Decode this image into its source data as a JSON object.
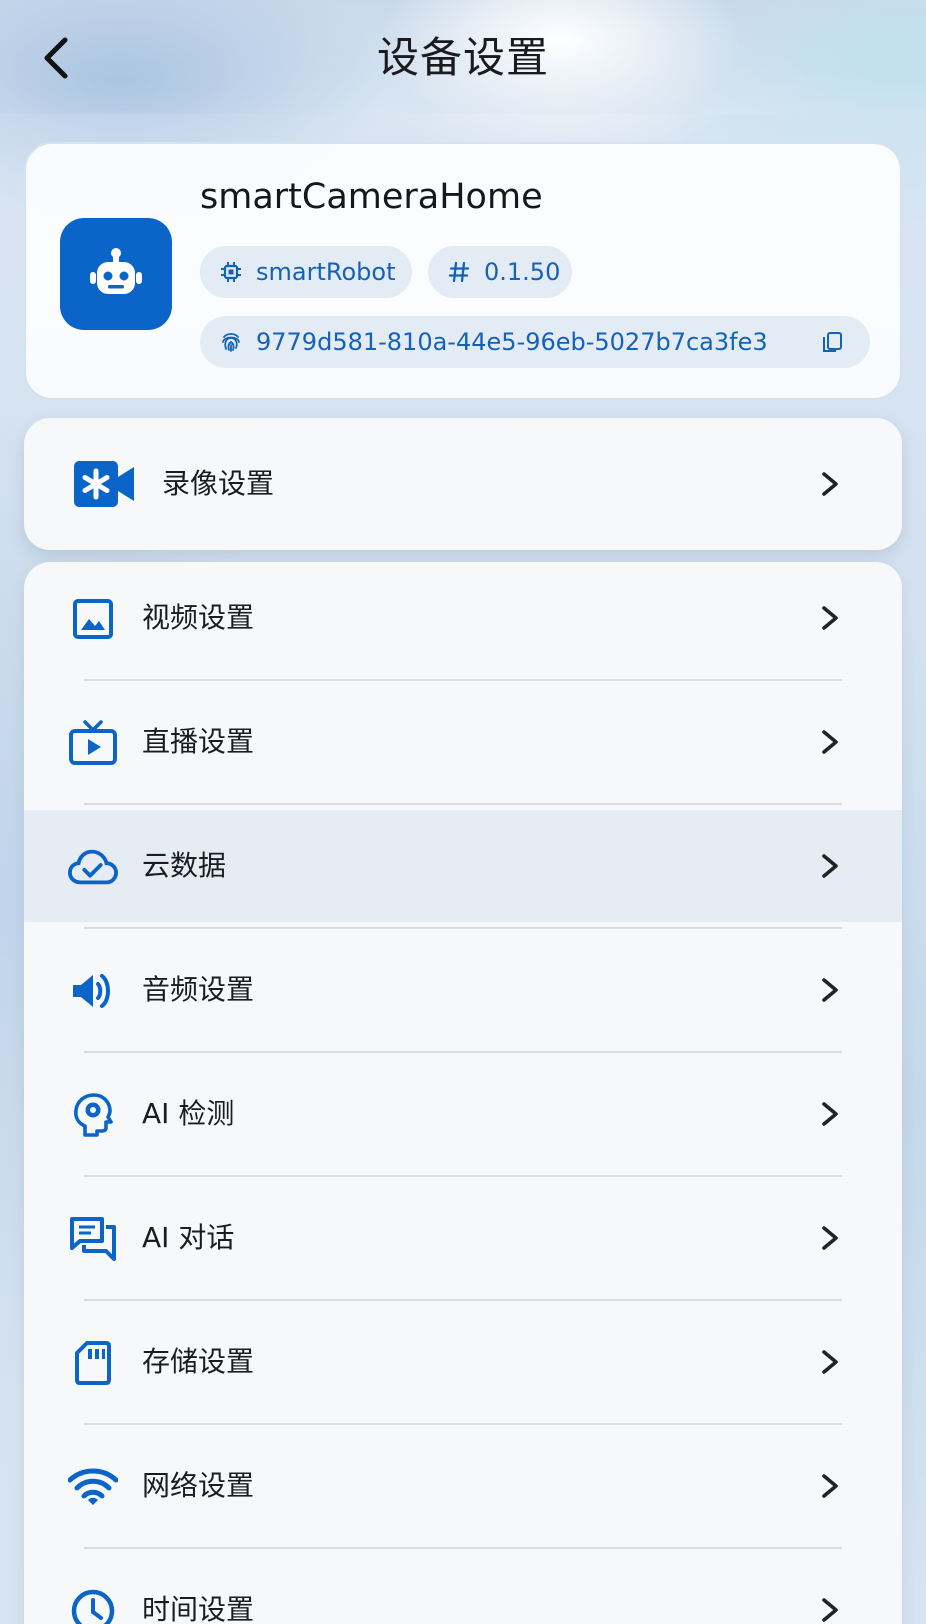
{
  "header": {
    "title": "设备设置",
    "back_icon": "chevron-left-icon"
  },
  "device": {
    "name": "smartCameraHome",
    "model": "smartRobot",
    "version": "0.1.50",
    "id": "9779d581-810a-44e5-96eb-5027b7ca3fe3",
    "avatar_icon": "robot-icon",
    "model_icon": "chip-icon",
    "version_icon": "hash-icon",
    "id_icon": "fingerprint-icon",
    "copy_icon": "copy-icon"
  },
  "record": {
    "label": "录像设置",
    "icon": "video-camera-icon"
  },
  "settings": [
    {
      "label": "视频设置",
      "icon": "image-icon"
    },
    {
      "label": "直播设置",
      "icon": "live-tv-icon"
    },
    {
      "label": "云数据",
      "icon": "cloud-done-icon",
      "highlighted": true
    },
    {
      "label": "音频设置",
      "icon": "speaker-icon"
    },
    {
      "label": "AI 检测",
      "icon": "psychology-icon"
    },
    {
      "label": "AI 对话",
      "icon": "chat-icon"
    },
    {
      "label": "存储设置",
      "icon": "sd-card-icon"
    },
    {
      "label": "网络设置",
      "icon": "wifi-icon"
    },
    {
      "label": "时间设置",
      "icon": "clock-icon"
    }
  ],
  "colors": {
    "accent": "#0b65c8",
    "chip_bg": "#e3ebf4",
    "chip_text": "#1462b8",
    "text": "#1b1c20"
  }
}
